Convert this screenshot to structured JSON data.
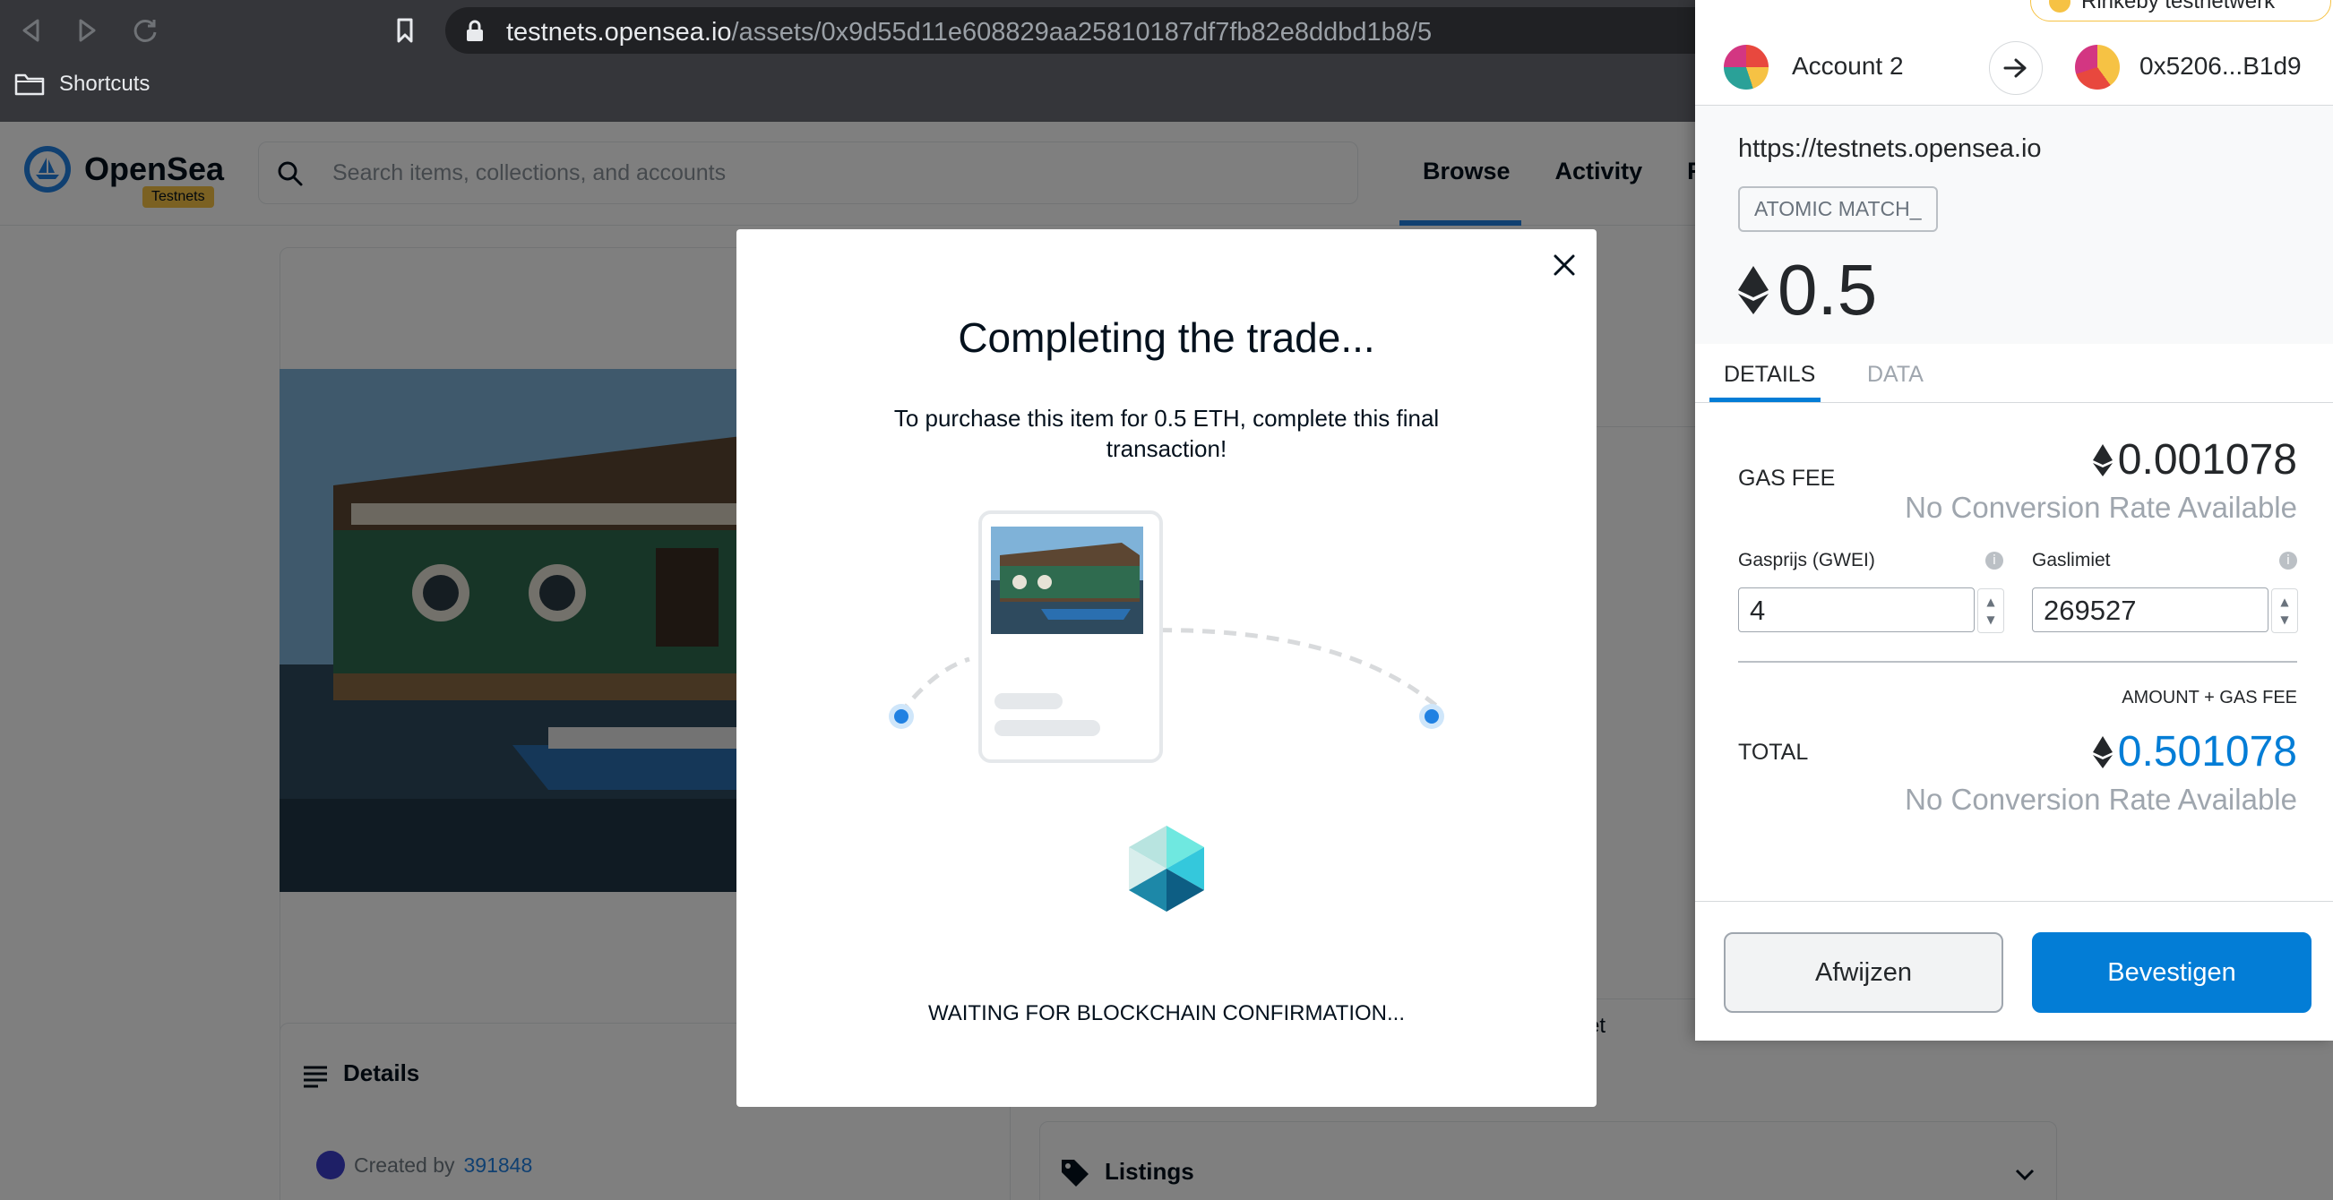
{
  "browser": {
    "url_host": "testnets.opensea.io",
    "url_path": "/assets/0x9d55d11e608829aa25810187df7fb82e8ddbd1b8/5",
    "bookmark_folder": "Shortcuts"
  },
  "opensea": {
    "brand": "OpenSea",
    "badge": "Testnets",
    "search_placeholder": "Search items, collections, and accounts",
    "nav": [
      "Browse",
      "Activity",
      "Ra"
    ],
    "details_title": "Details",
    "created_by_label": "Created by",
    "creator": "391848",
    "listings_title": "Listings",
    "side_text": "a yet"
  },
  "modal": {
    "title": "Completing the trade...",
    "description": "To purchase this item for 0.5 ETH, complete this final transaction!",
    "status": "WAITING FOR BLOCKCHAIN CONFIRMATION..."
  },
  "metamask": {
    "network": "Rinkeby testnetwerk",
    "from_account": "Account 2",
    "to_account": "0x5206...B1d9",
    "origin": "https://testnets.opensea.io",
    "method": "ATOMIC MATCH_",
    "amount": "0.5",
    "tabs": {
      "details": "DETAILS",
      "data": "DATA"
    },
    "gas_fee_label": "GAS FEE",
    "gas_fee_value": "0.001078",
    "no_rate": "No Conversion Rate Available",
    "gas_price_label": "Gasprijs (GWEI)",
    "gas_price_value": "4",
    "gas_limit_label": "Gaslimiet",
    "gas_limit_value": "269527",
    "amount_gas_label": "AMOUNT + GAS FEE",
    "total_label": "TOTAL",
    "total_value": "0.501078",
    "reject_label": "Afwijzen",
    "confirm_label": "Bevestigen"
  },
  "colors": {
    "accent_blue": "#037dd6",
    "opensea_blue": "#2081e2",
    "testnet_badge": "#f6c244"
  }
}
